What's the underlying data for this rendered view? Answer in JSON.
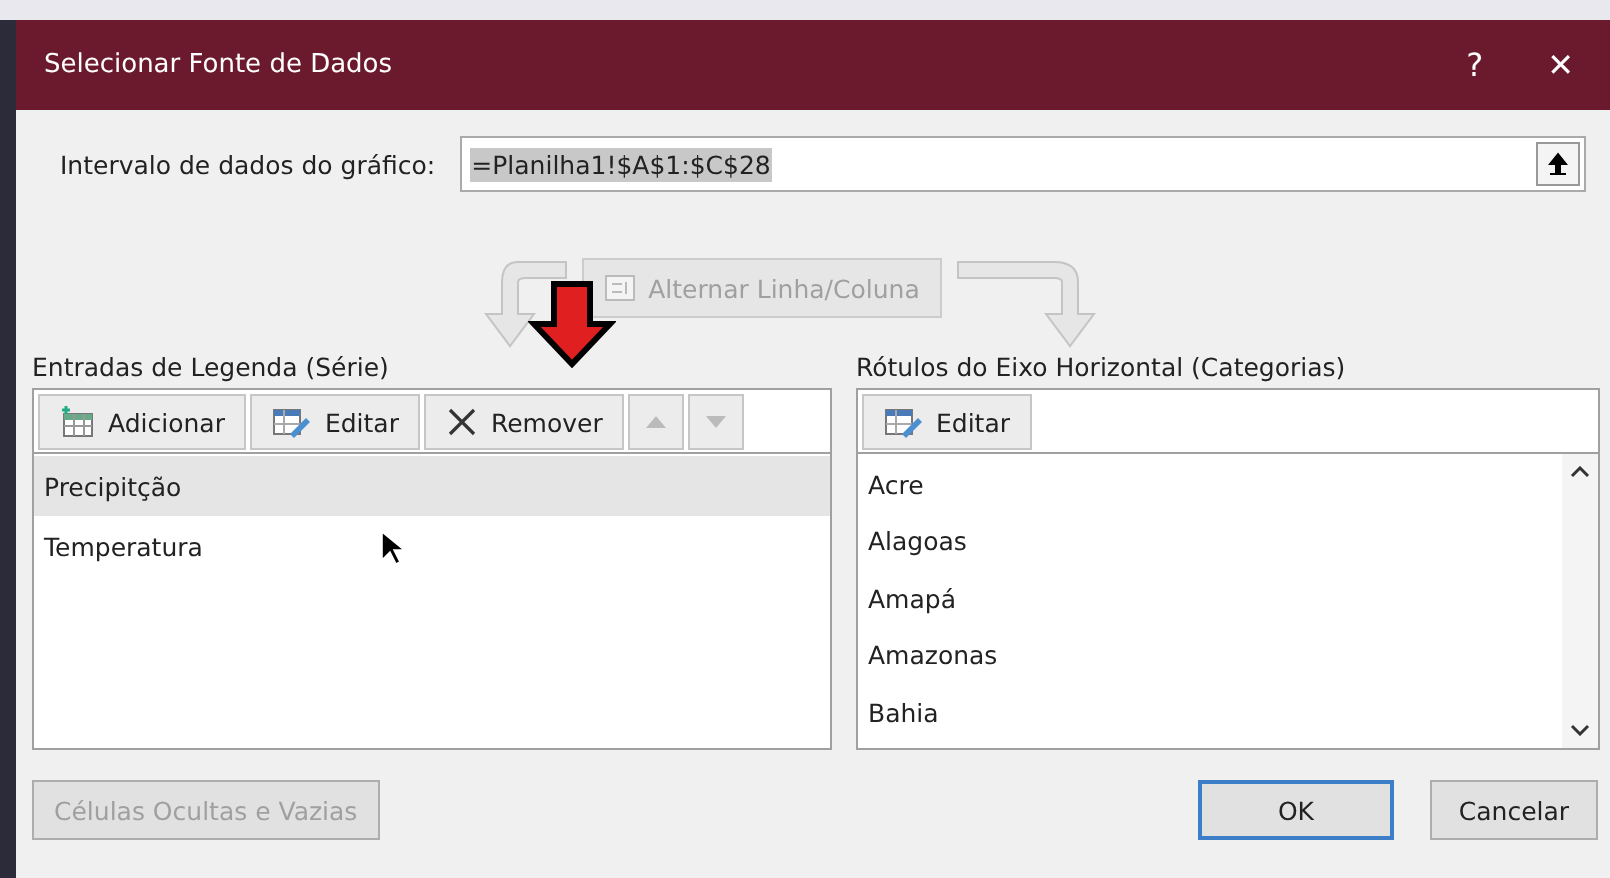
{
  "window": {
    "title": "Selecionar Fonte de Dados",
    "help": "?",
    "close": "✕"
  },
  "range": {
    "label": "Intervalo de dados do gráfico:",
    "value": "=Planilha1!$A$1:$C$28"
  },
  "switch_button": {
    "label": "Alternar Linha/Coluna",
    "disabled": true
  },
  "series_panel": {
    "title": "Entradas de Legenda (Série)",
    "toolbar": [
      {
        "kind": "add",
        "label": "Adicionar",
        "disabled": false
      },
      {
        "kind": "edit",
        "label": "Editar",
        "disabled": false
      },
      {
        "kind": "remove",
        "label": "Remover",
        "disabled": false
      },
      {
        "kind": "up",
        "disabled": true
      },
      {
        "kind": "down",
        "disabled": true
      }
    ],
    "items": [
      {
        "label": "Precipitção",
        "selected": true
      },
      {
        "label": "Temperatura",
        "selected": false
      }
    ]
  },
  "category_panel": {
    "title": "Rótulos do Eixo Horizontal (Categorias)",
    "toolbar": [
      {
        "kind": "edit",
        "label": "Editar",
        "disabled": false
      }
    ],
    "items": [
      {
        "label": "Acre",
        "selected": false
      },
      {
        "label": "Alagoas",
        "selected": false
      },
      {
        "label": "Amapá",
        "selected": false
      },
      {
        "label": "Amazonas",
        "selected": false
      },
      {
        "label": "Bahia",
        "selected": false
      }
    ]
  },
  "footer": {
    "hidden_cells": {
      "label": "Células Ocultas e Vazias",
      "disabled": true
    },
    "buttons": [
      {
        "label": "OK",
        "default": true
      },
      {
        "label": "Cancelar",
        "default": false
      }
    ]
  }
}
